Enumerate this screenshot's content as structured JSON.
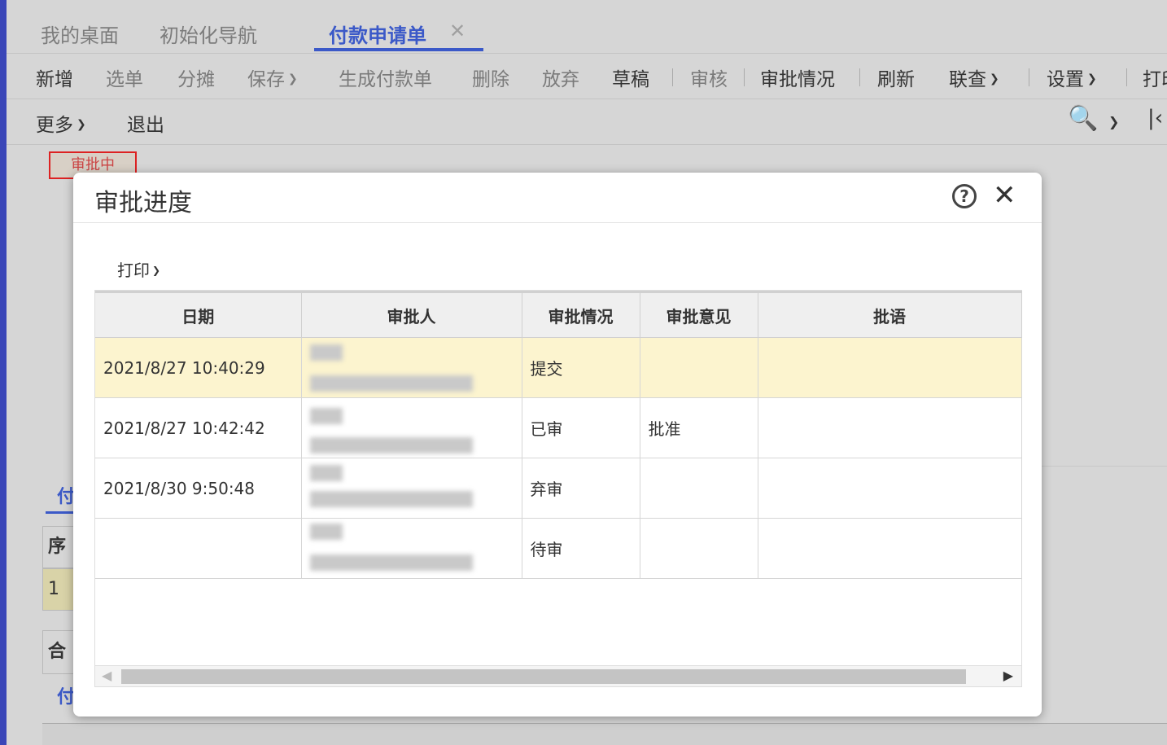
{
  "tabs": [
    {
      "label": "我的桌面"
    },
    {
      "label": "初始化导航"
    },
    {
      "label": "付款申请单"
    }
  ],
  "toolbar_primary": [
    "新增",
    "选单",
    "分摊",
    "保存",
    "生成付款单",
    "删除",
    "放弃",
    "草稿",
    "审核",
    "审批情况",
    "刷新",
    "联查",
    "设置",
    "打印"
  ],
  "toolbar_secondary": [
    "更多",
    "退出"
  ],
  "status_badge": "审批中",
  "background": {
    "subtab_1": "付",
    "subtab_2": "付",
    "row_header": "序",
    "row_value": "1",
    "total": "合"
  },
  "dialog": {
    "title": "审批进度",
    "print_label": "打印",
    "columns": [
      "日期",
      "审批人",
      "审批情况",
      "审批意见",
      "批语"
    ],
    "rows": [
      {
        "date": "2021/8/27 10:40:29",
        "status": "提交",
        "opinion": "",
        "comment": ""
      },
      {
        "date": "2021/8/27 10:42:42",
        "status": "已审",
        "opinion": "批准",
        "comment": ""
      },
      {
        "date": "2021/8/30 9:50:48",
        "status": "弃审",
        "opinion": "",
        "comment": ""
      },
      {
        "date": "",
        "status": "待审",
        "opinion": "",
        "comment": ""
      }
    ]
  },
  "colors": {
    "accent": "#3b59c8",
    "selected_row": "#fcf4cf",
    "badge": "#dd2222"
  }
}
